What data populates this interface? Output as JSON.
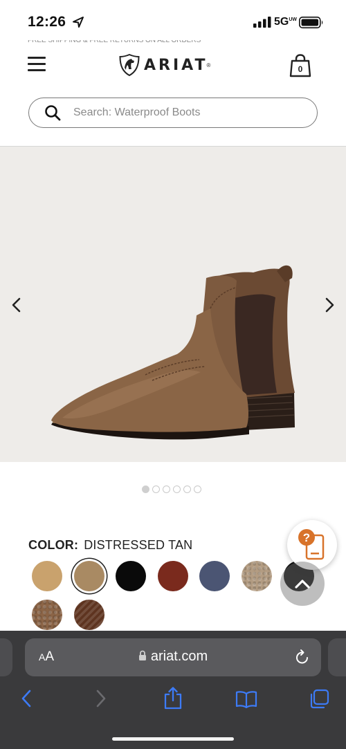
{
  "status_bar": {
    "time": "12:26",
    "network": "5G",
    "network_suffix": "UW"
  },
  "header": {
    "promo_text": "FREE SHIPPING & FREE RETURNS ON ALL ORDERS",
    "logo_text": "ARIAT",
    "cart_count": "0"
  },
  "search": {
    "placeholder": "Search: Waterproof Boots"
  },
  "gallery": {
    "image_count": 6,
    "active_index": 0
  },
  "color": {
    "label": "COLOR:",
    "value": "DISTRESSED TAN",
    "swatches": [
      {
        "name": "swatch-1",
        "color": "#c9a26d"
      },
      {
        "name": "swatch-distressed-tan",
        "color": "#a98a63"
      },
      {
        "name": "swatch-black",
        "color": "#0a0a0a"
      },
      {
        "name": "swatch-red-brown",
        "color": "#7a2a1d"
      },
      {
        "name": "swatch-navy",
        "color": "#4b5573"
      },
      {
        "name": "swatch-light-tan",
        "color": "#b39c82"
      },
      {
        "name": "swatch-black-2",
        "color": "#111111"
      },
      {
        "name": "swatch-cork",
        "color": "#8b6446"
      },
      {
        "name": "swatch-dark-brown",
        "color": "#5e3420"
      }
    ],
    "selected_index": 1
  },
  "help_button": {
    "glyph": "?"
  },
  "safari": {
    "text_size_label": "AA",
    "url": "ariat.com"
  },
  "colors": {
    "accent_orange": "#d8732a",
    "safari_blue": "#3d7bf6",
    "safari_bg": "#3a3a3c"
  }
}
